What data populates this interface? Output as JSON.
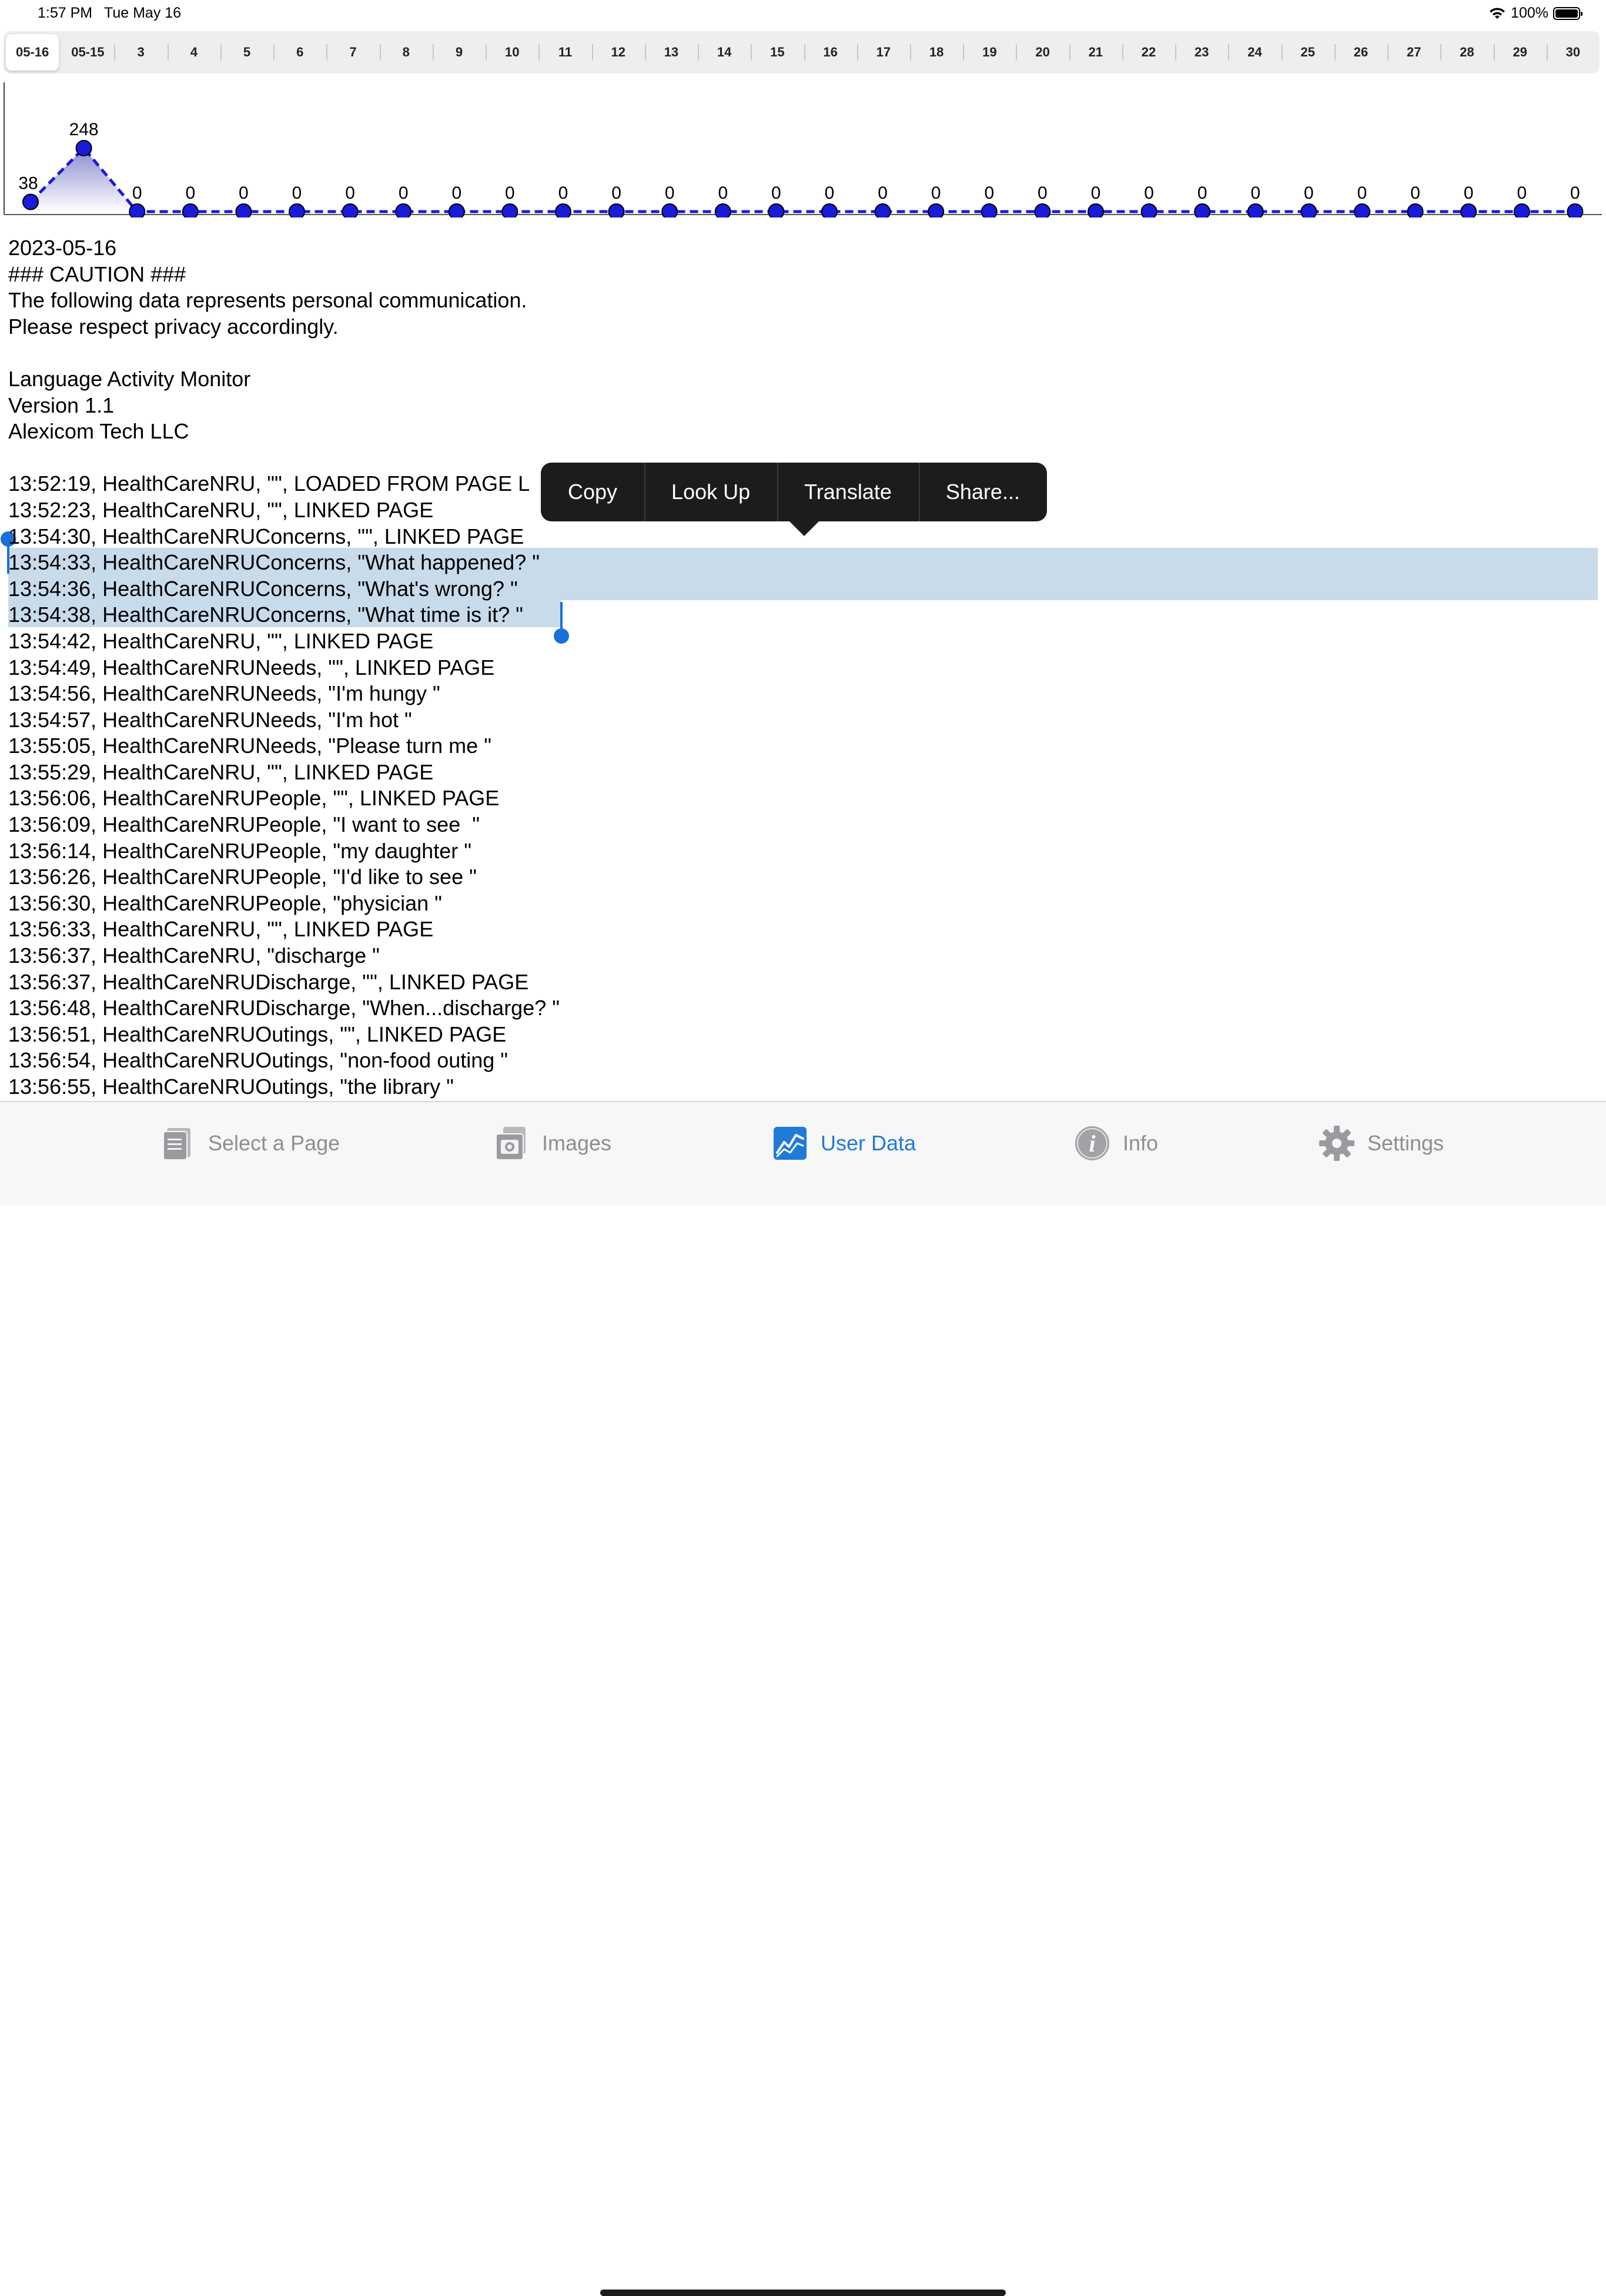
{
  "status_bar": {
    "time": "1:57 PM",
    "date": "Tue May 16",
    "battery": "100%"
  },
  "day_selector": {
    "segments": [
      "05-16",
      "05-15",
      "3",
      "4",
      "5",
      "6",
      "7",
      "8",
      "9",
      "10",
      "11",
      "12",
      "13",
      "14",
      "15",
      "16",
      "17",
      "18",
      "19",
      "20",
      "21",
      "22",
      "23",
      "24",
      "25",
      "26",
      "27",
      "28",
      "29",
      "30"
    ],
    "selected_index": 0
  },
  "chart_data": {
    "type": "area",
    "categories": [
      "05-16",
      "05-15",
      "3",
      "4",
      "5",
      "6",
      "7",
      "8",
      "9",
      "10",
      "11",
      "12",
      "13",
      "14",
      "15",
      "16",
      "17",
      "18",
      "19",
      "20",
      "21",
      "22",
      "23",
      "24",
      "25",
      "26",
      "27",
      "28",
      "29",
      "30"
    ],
    "values": [
      38,
      248,
      0,
      0,
      0,
      0,
      0,
      0,
      0,
      0,
      0,
      0,
      0,
      0,
      0,
      0,
      0,
      0,
      0,
      0,
      0,
      0,
      0,
      0,
      0,
      0,
      0,
      0,
      0,
      0
    ],
    "ylim": [
      0,
      248
    ],
    "line_color": "#1a1adb",
    "fill_color": "#8a8ad0"
  },
  "log": {
    "header_lines": [
      "2023-05-16",
      "### CAUTION ###",
      "The following data represents personal communication.",
      "Please respect privacy accordingly.",
      "",
      "Language Activity Monitor",
      "Version 1.1",
      "Alexicom Tech LLC",
      ""
    ],
    "entries": [
      "13:52:19, HealthCareNRU, \"\", LOADED FROM PAGE L",
      "13:52:23, HealthCareNRU, \"\", LINKED PAGE",
      "13:54:30, HealthCareNRUConcerns, \"\", LINKED PAGE",
      "13:54:33, HealthCareNRUConcerns, \"What happened? \"",
      "13:54:36, HealthCareNRUConcerns, \"What's wrong? \"",
      "13:54:38, HealthCareNRUConcerns, \"What time is it? \"",
      "13:54:42, HealthCareNRU, \"\", LINKED PAGE",
      "13:54:49, HealthCareNRUNeeds, \"\", LINKED PAGE",
      "13:54:56, HealthCareNRUNeeds, \"I'm hungy \"",
      "13:54:57, HealthCareNRUNeeds, \"I'm hot \"",
      "13:55:05, HealthCareNRUNeeds, \"Please turn me \"",
      "13:55:29, HealthCareNRU, \"\", LINKED PAGE",
      "13:56:06, HealthCareNRUPeople, \"\", LINKED PAGE",
      "13:56:09, HealthCareNRUPeople, \"I want to see  \"",
      "13:56:14, HealthCareNRUPeople, \"my daughter \"",
      "13:56:26, HealthCareNRUPeople, \"I'd like to see \"",
      "13:56:30, HealthCareNRUPeople, \"physician \"",
      "13:56:33, HealthCareNRU, \"\", LINKED PAGE",
      "13:56:37, HealthCareNRU, \"discharge \"",
      "13:56:37, HealthCareNRUDischarge, \"\", LINKED PAGE",
      "13:56:48, HealthCareNRUDischarge, \"When...discharge? \"",
      "13:56:51, HealthCareNRUOutings, \"\", LINKED PAGE",
      "13:56:54, HealthCareNRUOutings, \"non-food outing \"",
      "13:56:55, HealthCareNRUOutings, \"the library \""
    ]
  },
  "context_menu": {
    "items": [
      "Copy",
      "Look Up",
      "Translate",
      "Share..."
    ]
  },
  "tab_bar": {
    "tabs": [
      {
        "label": "Select a Page",
        "icon": "pages-icon",
        "active": false
      },
      {
        "label": "Images",
        "icon": "images-icon",
        "active": false
      },
      {
        "label": "User Data",
        "icon": "chart-icon",
        "active": true
      },
      {
        "label": "Info",
        "icon": "info-icon",
        "active": false
      },
      {
        "label": "Settings",
        "icon": "gear-icon",
        "active": false
      }
    ]
  }
}
